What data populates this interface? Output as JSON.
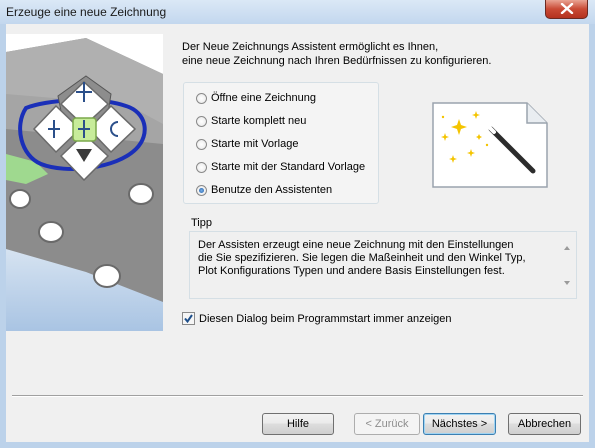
{
  "window": {
    "title": "Erzeuge eine neue Zeichnung"
  },
  "intro": {
    "line1": "Der Neue Zeichnungs Assistent ermöglicht es Ihnen,",
    "line2": "eine neue Zeichnung nach Ihren Bedürfnissen zu konfigurieren."
  },
  "options": [
    {
      "label": "Öffne eine Zeichnung",
      "selected": false
    },
    {
      "label": "Starte komplett neu",
      "selected": false
    },
    {
      "label": "Starte mit Vorlage",
      "selected": false
    },
    {
      "label": "Starte mit der Standard Vorlage",
      "selected": false
    },
    {
      "label": "Benutze den Assistenten",
      "selected": true
    }
  ],
  "tip": {
    "label": "Tipp",
    "line1": "Der Assisten erzeugt eine neue Zeichnung mit den Einstellungen",
    "line2": "die Sie spezifizieren. Sie legen die Maßeinheit und den Winkel Typ,",
    "line3": "Plot Konfigurations Typen und andere Basis Einstellungen fest."
  },
  "startup_checkbox": {
    "label": "Diesen Dialog beim Programmstart immer anzeigen",
    "checked": true
  },
  "buttons": {
    "help": "Hilfe",
    "back": "< Zurück",
    "next": "Nächstes >",
    "cancel": "Abbrechen"
  },
  "icons": {
    "close": "close-icon",
    "illustration": "viewcube-navigation-illustration",
    "wizard": "magic-wand-document-icon"
  },
  "colors": {
    "title_bar": "#c3d7ee",
    "close_button": "#c94a35",
    "dialog_bg": "#f0f0f0",
    "radio_selected": "#1e5da8",
    "checkbox_check": "#1e4f8a"
  }
}
